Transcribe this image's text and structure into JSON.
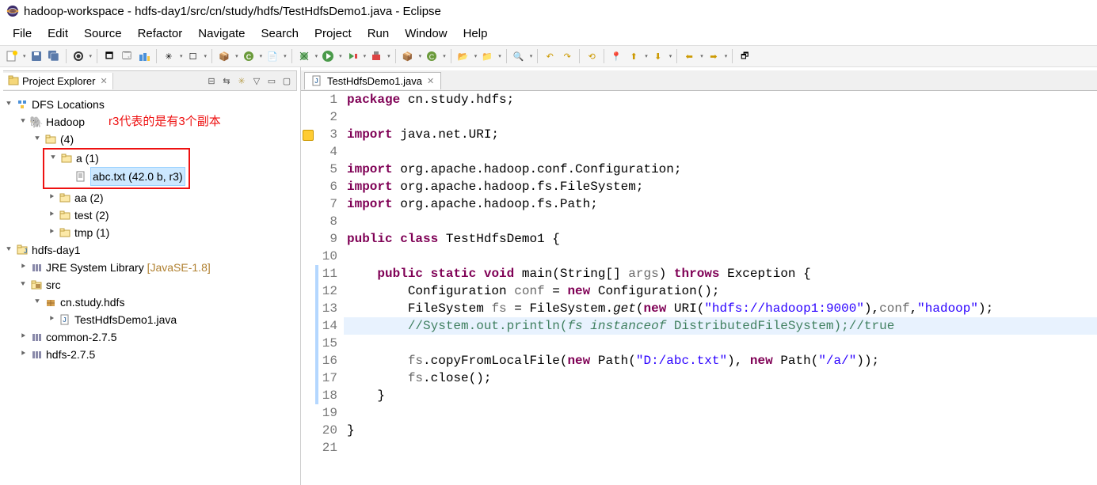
{
  "window_title": "hadoop-workspace - hdfs-day1/src/cn/study/hdfs/TestHdfsDemo1.java - Eclipse",
  "menu": [
    "File",
    "Edit",
    "Source",
    "Refactor",
    "Navigate",
    "Search",
    "Project",
    "Run",
    "Window",
    "Help"
  ],
  "project_explorer": {
    "title": "Project Explorer",
    "red_note": "r3代表的是有3个副本",
    "dfs_root": "DFS Locations",
    "hadoop": "Hadoop",
    "hadoop_count": "(4)",
    "a_folder": "a (1)",
    "abc_file": "abc.txt (42.0 b, r3)",
    "aa_folder": "aa (2)",
    "test_folder": "test (2)",
    "tmp_folder": "tmp (1)",
    "project": "hdfs-day1",
    "jre": "JRE System Library",
    "jre_suffix": " [JavaSE-1.8]",
    "src": "src",
    "pkg": "cn.study.hdfs",
    "java_file": "TestHdfsDemo1.java",
    "common": "common-2.7.5",
    "hdfs": "hdfs-2.7.5"
  },
  "editor": {
    "tab_title": "TestHdfsDemo1.java",
    "code": {
      "l1_pkg": "package",
      "l1_rest": " cn.study.hdfs;",
      "l3_imp": "import",
      "l3_rest": " java.net.URI;",
      "l5_rest": " org.apache.hadoop.conf.Configuration;",
      "l6_rest": " org.apache.hadoop.fs.FileSystem;",
      "l7_rest": " org.apache.hadoop.fs.Path;",
      "l9_public": "public",
      "l9_class": "class",
      "l9_name": " TestHdfsDemo1 {",
      "l11_public": "public",
      "l11_static": "static",
      "l11_void": "void",
      "l11_main": " main(String[] ",
      "l11_args": "args",
      "l11_paren": ") ",
      "l11_throws": "throws",
      "l11_exc": " Exception {",
      "l12_a": "        Configuration ",
      "l12_conf": "conf",
      "l12_b": " = ",
      "l12_new": "new",
      "l12_c": " Configuration();",
      "l13_a": "        FileSystem ",
      "l13_fs": "fs",
      "l13_b": " = FileSystem.",
      "l13_get": "get",
      "l13_c": "(",
      "l13_new": "new",
      "l13_d": " URI(",
      "l13_str1": "\"hdfs://hadoop1:9000\"",
      "l13_e": "),",
      "l13_conf": "conf",
      "l13_f": ",",
      "l13_str2": "\"hadoop\"",
      "l13_g": ");",
      "l14_cmt_a": "        //System.out.println(",
      "l14_cmt_fs": "fs",
      "l14_cmt_b": " ",
      "l14_cmt_inst": "instanceof",
      "l14_cmt_c": " DistributedFileSystem);//true",
      "l16_a": "        ",
      "l16_fs": "fs",
      "l16_b": ".copyFromLocalFile(",
      "l16_new": "new",
      "l16_c": " Path(",
      "l16_str1": "\"D:/abc.txt\"",
      "l16_d": "), ",
      "l16_new2": "new",
      "l16_e": " Path(",
      "l16_str2": "\"/a/\"",
      "l16_f": "));",
      "l17_a": "        ",
      "l17_fs": "fs",
      "l17_b": ".close();",
      "l18": "    }",
      "l20": "}"
    }
  }
}
